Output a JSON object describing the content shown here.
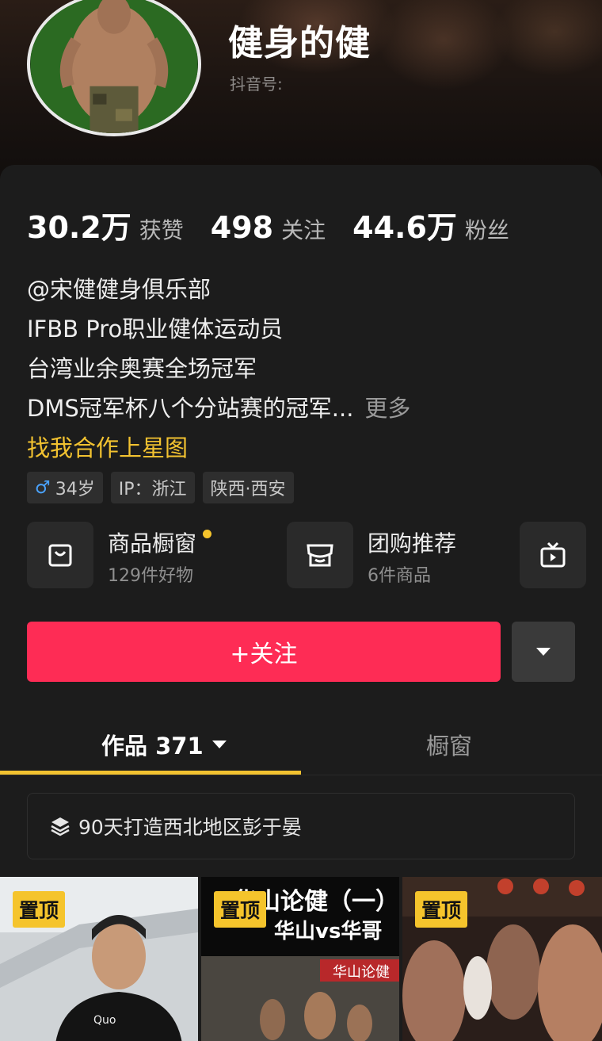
{
  "profile": {
    "nickname": "健身的健",
    "douyin_id_label": "抖音号:"
  },
  "stats": [
    {
      "value": "30.2万",
      "label": "获赞"
    },
    {
      "value": "498",
      "label": "关注"
    },
    {
      "value": "44.6万",
      "label": "粉丝"
    }
  ],
  "bio": {
    "lines": [
      "@宋健健身俱乐部",
      "IFBB Pro职业健体运动员",
      "台湾业余奥赛全场冠军",
      "DMS冠军杯八个分站赛的冠军..."
    ],
    "more": "更多",
    "link": "找我合作上星图"
  },
  "tags": {
    "age": "34岁",
    "ip": "IP：浙江",
    "location": "陕西·西安"
  },
  "shortcuts": [
    {
      "title": "商品橱窗",
      "subtitle": "129件好物",
      "icon": "bag-icon"
    },
    {
      "title": "团购推荐",
      "subtitle": "6件商品",
      "icon": "store-icon"
    },
    {
      "icon": "tv-icon"
    }
  ],
  "actions": {
    "follow": "+关注"
  },
  "tabs": {
    "works_label": "作品 371",
    "showcase_label": "橱窗"
  },
  "collection": {
    "title": "90天打造西北地区彭于晏"
  },
  "videos": [
    {
      "pin": "置顶"
    },
    {
      "pin": "置顶",
      "overlay_text": "华山论健（一）",
      "overlay_sub": "华山vs华哥",
      "banner": "华山论健"
    },
    {
      "pin": "置顶"
    }
  ],
  "colors": {
    "accent": "#fe2c55",
    "highlight": "#f2c230",
    "pin": "#f5c42c",
    "background": "#1c1c1c"
  }
}
